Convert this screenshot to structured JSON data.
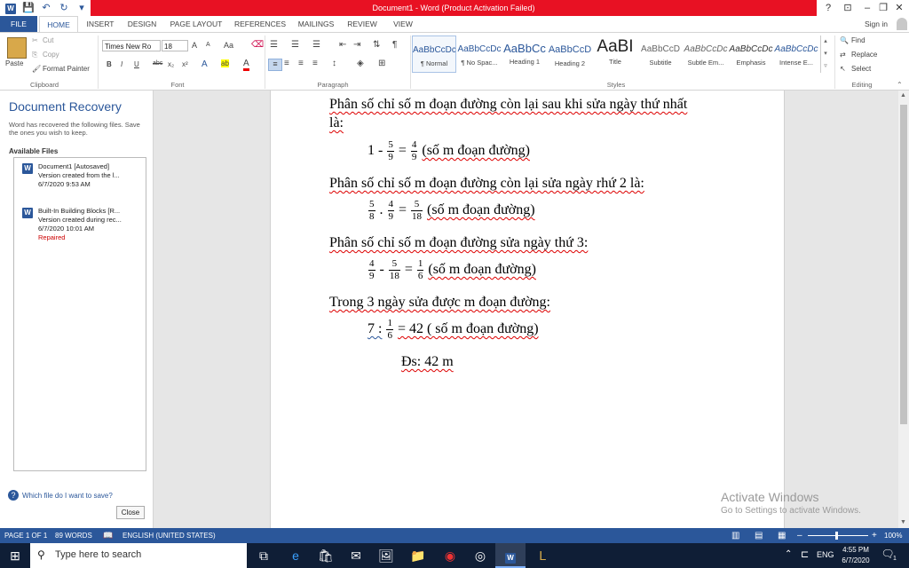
{
  "title_bar": {
    "title": "Document1 - Word (Product Activation Failed)",
    "help": "?",
    "ribbon_display": "⊡",
    "minimize": "–",
    "restore": "❐",
    "close": "✕",
    "sign_in": "Sign in"
  },
  "tabs": [
    "FILE",
    "HOME",
    "INSERT",
    "DESIGN",
    "PAGE LAYOUT",
    "REFERENCES",
    "MAILINGS",
    "REVIEW",
    "VIEW"
  ],
  "ribbon": {
    "clipboard": {
      "paste": "Paste",
      "cut": "Cut",
      "copy": "Copy",
      "format_painter": "Format Painter",
      "label": "Clipboard"
    },
    "font": {
      "name": "Times New Ro",
      "size": "18",
      "label": "Font",
      "bold": "B",
      "italic": "I",
      "underline": "U",
      "strike": "abc",
      "subscript": "x₂",
      "superscript": "x²",
      "grow": "A",
      "shrink": "A",
      "case": "Aa",
      "text_effects": "A",
      "highlight": "ab",
      "color": "A"
    },
    "paragraph": {
      "label": "Paragraph"
    },
    "styles": {
      "label": "Styles",
      "items": [
        {
          "preview": "AaBbCcDc",
          "name": "¶ Normal"
        },
        {
          "preview": "AaBbCcDc",
          "name": "¶ No Spac..."
        },
        {
          "preview": "AaBbCc",
          "name": "Heading 1"
        },
        {
          "preview": "AaBbCcD",
          "name": "Heading 2"
        },
        {
          "preview": "AaBI",
          "name": "Title"
        },
        {
          "preview": "AaBbCcD",
          "name": "Subtitle"
        },
        {
          "preview": "AaBbCcDc",
          "name": "Subtle Em..."
        },
        {
          "preview": "AaBbCcDc",
          "name": "Emphasis"
        },
        {
          "preview": "AaBbCcDc",
          "name": "Intense E..."
        }
      ]
    },
    "editing": {
      "find": "Find",
      "replace": "Replace",
      "select": "Select",
      "label": "Editing"
    }
  },
  "recovery": {
    "title": "Document Recovery",
    "description": "Word has recovered the following files. Save the ones you wish to keep.",
    "available_files": "Available Files",
    "files": [
      {
        "name": "Document1  [Autosaved]",
        "line2": "Version created from the l...",
        "date": "6/7/2020 9:53 AM",
        "status": ""
      },
      {
        "name": "Built-In Building Blocks  [R...",
        "line2": "Version created during rec...",
        "date": "6/7/2020 10:01 AM",
        "status": "Repaired"
      }
    ],
    "help_link": "Which file do I want to save?",
    "close_button": "Close"
  },
  "document": {
    "line1a": "Phân số chỉ số m đoạn đường còn lại sau khi sửa ngày thứ nhất",
    "line1b": "là:",
    "eq1_pre": "1 -",
    "eq1_f1": [
      "5",
      "9"
    ],
    "eq1_eq": "=",
    "eq1_f2": [
      "4",
      "9"
    ],
    "eq1_post": "(số m đoạn đường)",
    "line2": "Phân số chỉ số m đoạn đường còn lại sửa ngày rhứ 2 là:",
    "eq2_f1": [
      "5",
      "8"
    ],
    "eq2_op": ".",
    "eq2_f2": [
      "4",
      "9"
    ],
    "eq2_eq": "=",
    "eq2_f3": [
      "5",
      "18"
    ],
    "eq2_post": "(số m đoạn đường)",
    "line3": "Phân số chỉ số m đoạn đường sửa ngày thứ 3:",
    "eq3_f1": [
      "4",
      "9"
    ],
    "eq3_op": "-",
    "eq3_f2": [
      "5",
      "18"
    ],
    "eq3_eq": "=",
    "eq3_f3": [
      "1",
      "6"
    ],
    "eq3_post": "(số m đoạn đường)",
    "line4": "Trong 3 ngày sửa được m đoạn đường:",
    "eq4_pre": "7 :",
    "eq4_f1": [
      "1",
      "6"
    ],
    "eq4_post": "= 42 ( số m đoạn đường)",
    "answer": "Đs: 42 m"
  },
  "watermark": {
    "line1": "Activate Windows",
    "line2": "Go to Settings to activate Windows."
  },
  "status_bar": {
    "page": "PAGE 1 OF 1",
    "words": "89 WORDS",
    "language": "ENGLISH (UNITED STATES)",
    "zoom": "100%"
  },
  "taskbar": {
    "search_placeholder": "Type here to search",
    "language": "ENG",
    "time": "4:55 PM",
    "date": "6/7/2020",
    "notifications": "1"
  },
  "colors": {
    "accent": "#2b579a",
    "activation_red": "#e81123",
    "taskbar": "#0f1e36"
  }
}
